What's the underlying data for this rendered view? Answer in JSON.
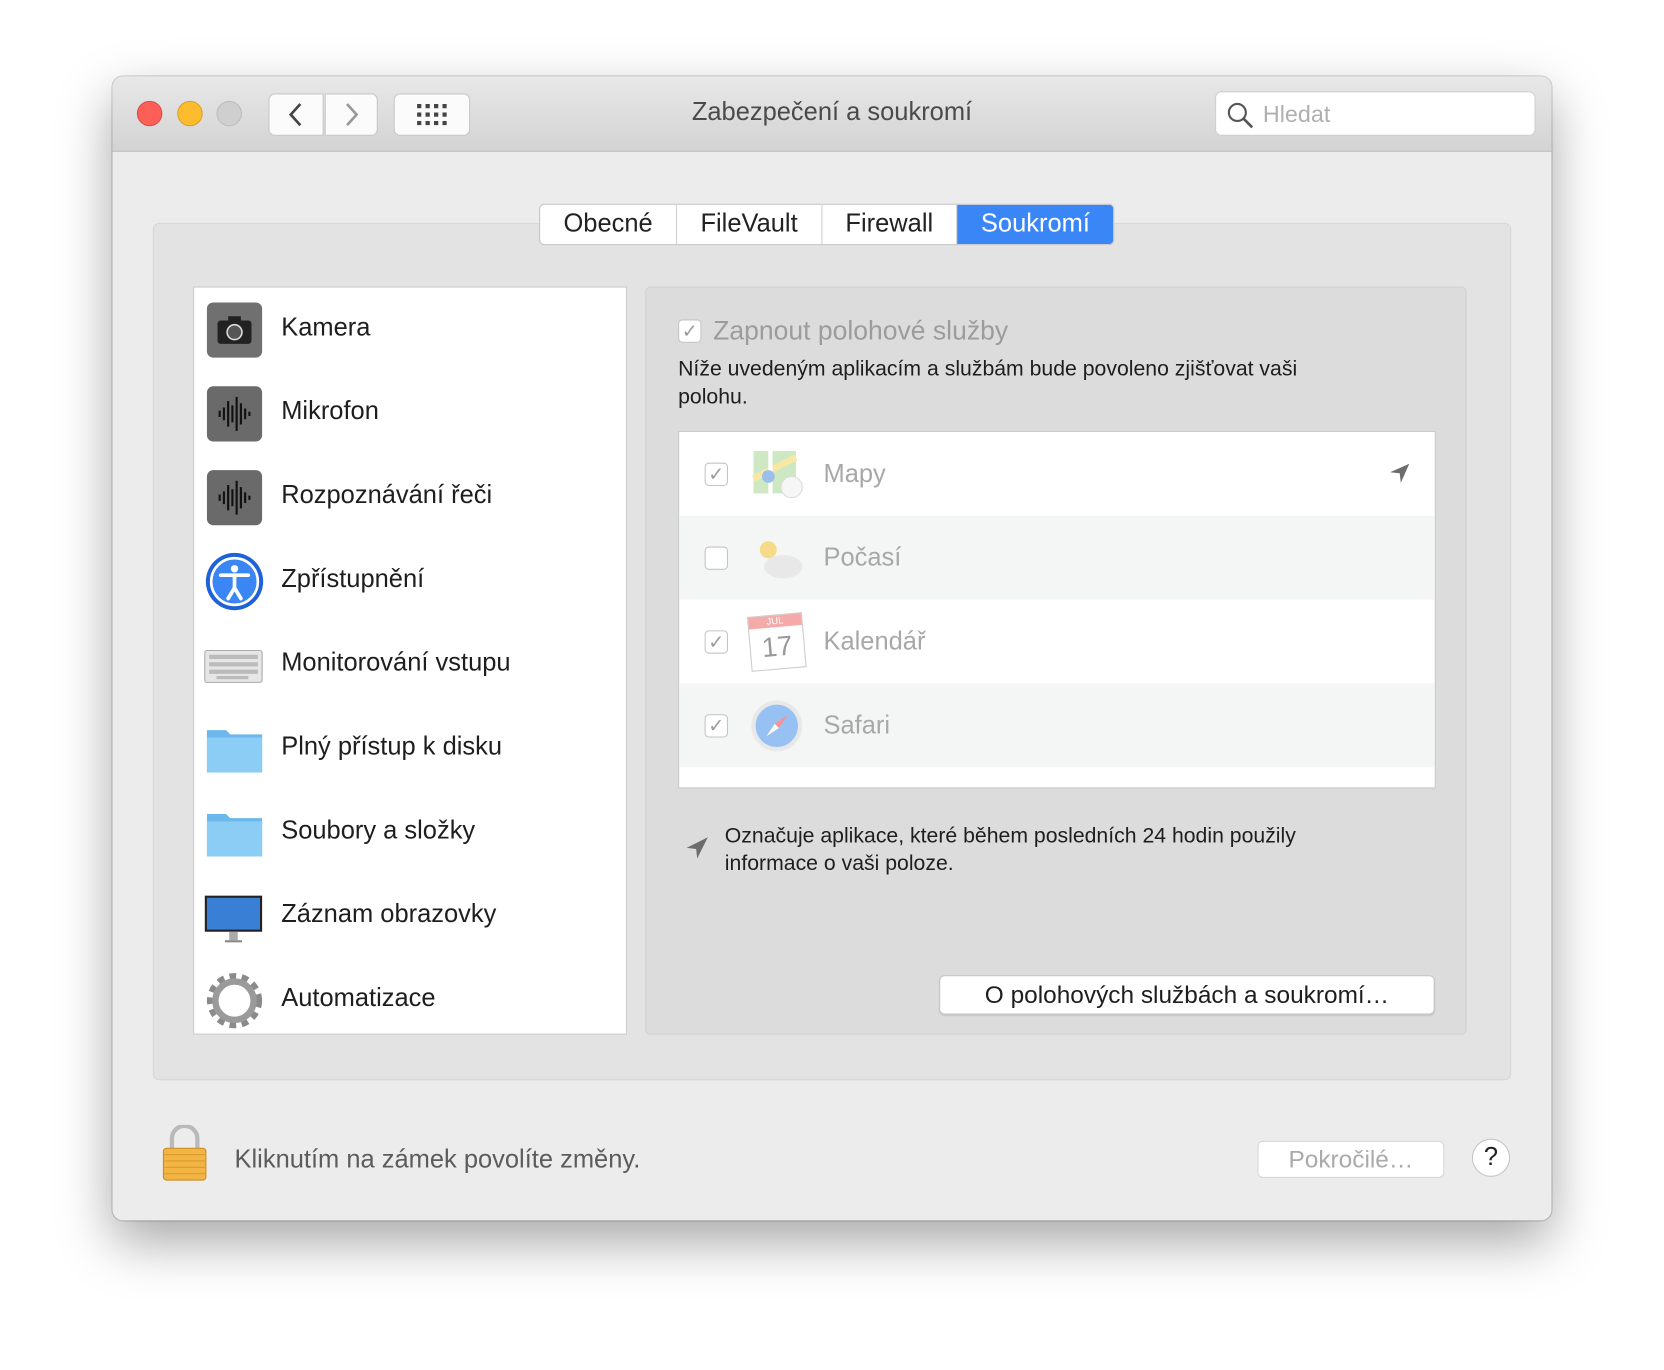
{
  "window": {
    "title": "Zabezpečení a soukromí",
    "search_placeholder": "Hledat"
  },
  "tabs": [
    {
      "label": "Obecné"
    },
    {
      "label": "FileVault"
    },
    {
      "label": "Firewall"
    },
    {
      "label": "Soukromí",
      "selected": true
    }
  ],
  "sidebar": {
    "items": [
      {
        "label": "Kamera",
        "icon": "camera-icon"
      },
      {
        "label": "Mikrofon",
        "icon": "microphone-icon"
      },
      {
        "label": "Rozpoznávání řeči",
        "icon": "speech-recognition-icon"
      },
      {
        "label": "Zpřístupnění",
        "icon": "accessibility-icon"
      },
      {
        "label": "Monitorování vstupu",
        "icon": "keyboard-icon"
      },
      {
        "label": "Plný přístup k disku",
        "icon": "folder-icon"
      },
      {
        "label": "Soubory a složky",
        "icon": "folder-icon"
      },
      {
        "label": "Záznam obrazovky",
        "icon": "display-icon"
      },
      {
        "label": "Automatizace",
        "icon": "gear-icon"
      }
    ]
  },
  "location": {
    "enable_label": "Zapnout polohové služby",
    "enabled": true,
    "description": "Níže uvedeným aplikacím a službám bude povoleno zjišťovat vaši polohu.",
    "apps": [
      {
        "name": "Mapy",
        "checked": true,
        "recent": true,
        "icon": "maps-icon"
      },
      {
        "name": "Počasí",
        "checked": false,
        "icon": "weather-icon"
      },
      {
        "name": "Kalendář",
        "checked": true,
        "icon": "calendar-icon",
        "calendar_month": "JUL",
        "calendar_day": "17"
      },
      {
        "name": "Safari",
        "checked": true,
        "icon": "safari-icon"
      }
    ],
    "note": "Označuje aplikace, které během posledních 24 hodin použily informace o vaši poloze.",
    "about_button": "O polohových službách a soukromí…"
  },
  "footer": {
    "lock_text": "Kliknutím na zámek povolíte změny.",
    "advanced_button": "Pokročilé…",
    "help_button": "?"
  },
  "colors": {
    "accent": "#3b86f7",
    "close": "#fc5f57",
    "minimize": "#fdbc2e",
    "zoom_disabled": "#cfcfcf"
  }
}
